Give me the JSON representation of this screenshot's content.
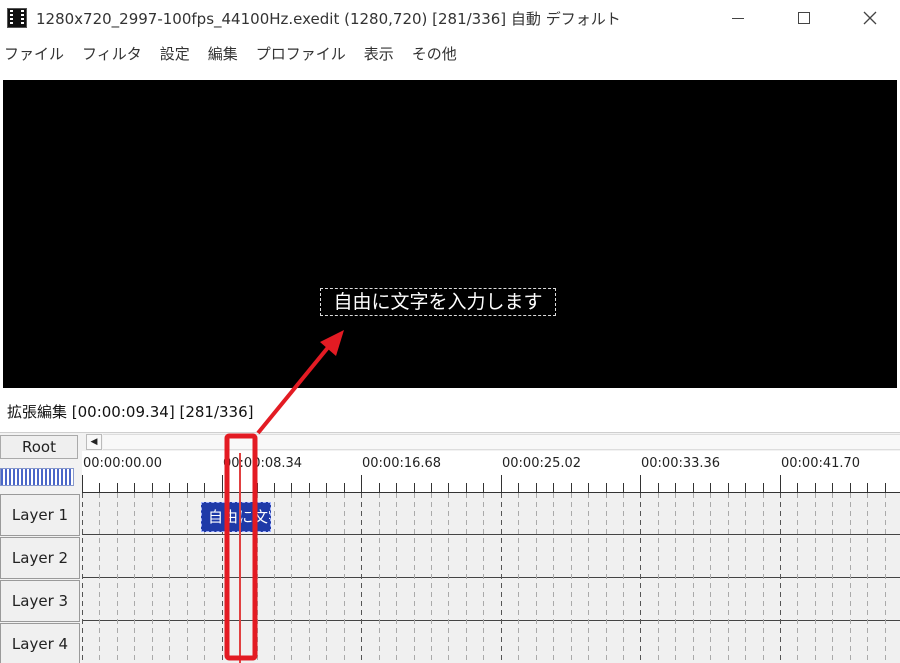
{
  "window": {
    "title": "1280x720_2997-100fps_44100Hz.exedit (1280,720)  [281/336]  自動  デフォルト"
  },
  "menu": {
    "items": [
      "ファイル",
      "フィルタ",
      "設定",
      "編集",
      "プロファイル",
      "表示",
      "その他"
    ]
  },
  "preview": {
    "text": "自由に文字を入力します"
  },
  "extended_edit": {
    "header": "拡張編集 [00:00:09.34] [281/336]",
    "root_label": "Root"
  },
  "timeline": {
    "ruler_labels": [
      "00:00:00.00",
      "00:00:08.34",
      "00:00:16.68",
      "00:00:25.02",
      "00:00:33.36",
      "00:00:41.70"
    ],
    "layers": [
      "Layer 1",
      "Layer 2",
      "Layer 3",
      "Layer 4"
    ],
    "object_text": "自由に文字"
  },
  "colors": {
    "accent": "#e31b23",
    "object_fill": "#1f3aa8",
    "preview_bg": "#000000"
  }
}
